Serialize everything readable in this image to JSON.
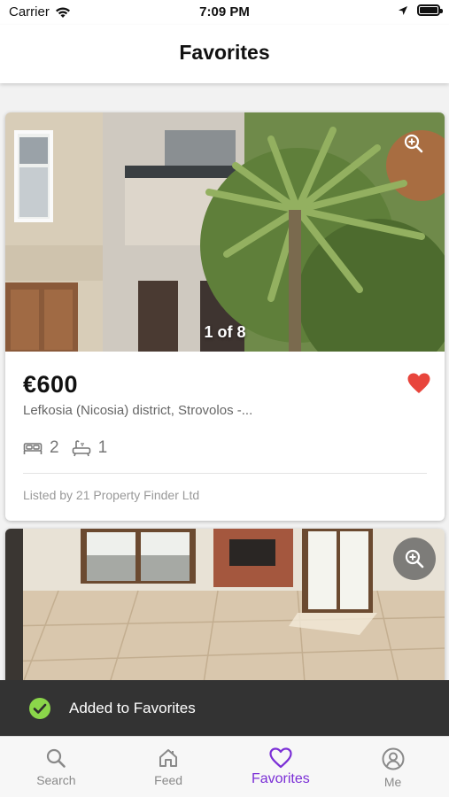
{
  "status_bar": {
    "carrier": "Carrier",
    "time": "7:09 PM"
  },
  "header": {
    "title": "Favorites"
  },
  "listings": [
    {
      "price": "€600",
      "location": "Lefkosia (Nicosia) district, Strovolos -...",
      "bedrooms": "2",
      "bathrooms": "1",
      "listed_by": "Listed by 21 Property Finder Ltd",
      "photo_counter": "1 of 8",
      "favorited": true
    }
  ],
  "toast": {
    "message": "Added to Favorites"
  },
  "tabbar": {
    "tabs": [
      {
        "label": "Search",
        "icon": "search-icon"
      },
      {
        "label": "Feed",
        "icon": "home-icon"
      },
      {
        "label": "Favorites",
        "icon": "heart-icon",
        "active": true
      },
      {
        "label": "Me",
        "icon": "user-circle-icon"
      }
    ]
  },
  "colors": {
    "accent": "#7b2fd6",
    "heart": "#e8453c",
    "toast_bg": "#333333",
    "toast_check": "#8bd64a"
  }
}
